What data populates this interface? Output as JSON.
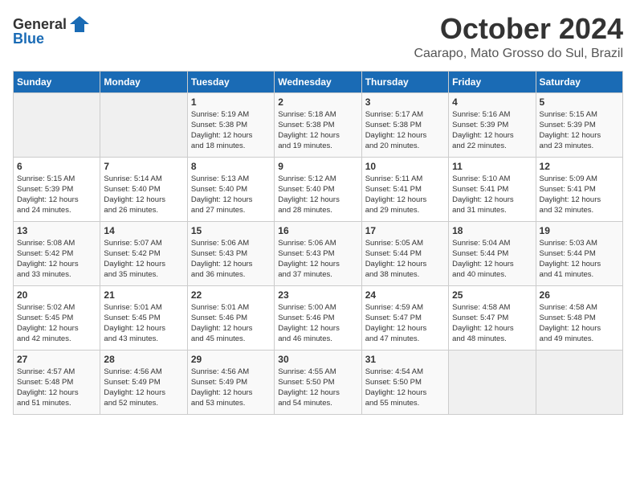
{
  "header": {
    "logo_general": "General",
    "logo_blue": "Blue",
    "month": "October 2024",
    "location": "Caarapo, Mato Grosso do Sul, Brazil"
  },
  "weekdays": [
    "Sunday",
    "Monday",
    "Tuesday",
    "Wednesday",
    "Thursday",
    "Friday",
    "Saturday"
  ],
  "weeks": [
    [
      {
        "day": "",
        "info": ""
      },
      {
        "day": "",
        "info": ""
      },
      {
        "day": "1",
        "info": "Sunrise: 5:19 AM\nSunset: 5:38 PM\nDaylight: 12 hours\nand 18 minutes."
      },
      {
        "day": "2",
        "info": "Sunrise: 5:18 AM\nSunset: 5:38 PM\nDaylight: 12 hours\nand 19 minutes."
      },
      {
        "day": "3",
        "info": "Sunrise: 5:17 AM\nSunset: 5:38 PM\nDaylight: 12 hours\nand 20 minutes."
      },
      {
        "day": "4",
        "info": "Sunrise: 5:16 AM\nSunset: 5:39 PM\nDaylight: 12 hours\nand 22 minutes."
      },
      {
        "day": "5",
        "info": "Sunrise: 5:15 AM\nSunset: 5:39 PM\nDaylight: 12 hours\nand 23 minutes."
      }
    ],
    [
      {
        "day": "6",
        "info": "Sunrise: 5:15 AM\nSunset: 5:39 PM\nDaylight: 12 hours\nand 24 minutes."
      },
      {
        "day": "7",
        "info": "Sunrise: 5:14 AM\nSunset: 5:40 PM\nDaylight: 12 hours\nand 26 minutes."
      },
      {
        "day": "8",
        "info": "Sunrise: 5:13 AM\nSunset: 5:40 PM\nDaylight: 12 hours\nand 27 minutes."
      },
      {
        "day": "9",
        "info": "Sunrise: 5:12 AM\nSunset: 5:40 PM\nDaylight: 12 hours\nand 28 minutes."
      },
      {
        "day": "10",
        "info": "Sunrise: 5:11 AM\nSunset: 5:41 PM\nDaylight: 12 hours\nand 29 minutes."
      },
      {
        "day": "11",
        "info": "Sunrise: 5:10 AM\nSunset: 5:41 PM\nDaylight: 12 hours\nand 31 minutes."
      },
      {
        "day": "12",
        "info": "Sunrise: 5:09 AM\nSunset: 5:41 PM\nDaylight: 12 hours\nand 32 minutes."
      }
    ],
    [
      {
        "day": "13",
        "info": "Sunrise: 5:08 AM\nSunset: 5:42 PM\nDaylight: 12 hours\nand 33 minutes."
      },
      {
        "day": "14",
        "info": "Sunrise: 5:07 AM\nSunset: 5:42 PM\nDaylight: 12 hours\nand 35 minutes."
      },
      {
        "day": "15",
        "info": "Sunrise: 5:06 AM\nSunset: 5:43 PM\nDaylight: 12 hours\nand 36 minutes."
      },
      {
        "day": "16",
        "info": "Sunrise: 5:06 AM\nSunset: 5:43 PM\nDaylight: 12 hours\nand 37 minutes."
      },
      {
        "day": "17",
        "info": "Sunrise: 5:05 AM\nSunset: 5:44 PM\nDaylight: 12 hours\nand 38 minutes."
      },
      {
        "day": "18",
        "info": "Sunrise: 5:04 AM\nSunset: 5:44 PM\nDaylight: 12 hours\nand 40 minutes."
      },
      {
        "day": "19",
        "info": "Sunrise: 5:03 AM\nSunset: 5:44 PM\nDaylight: 12 hours\nand 41 minutes."
      }
    ],
    [
      {
        "day": "20",
        "info": "Sunrise: 5:02 AM\nSunset: 5:45 PM\nDaylight: 12 hours\nand 42 minutes."
      },
      {
        "day": "21",
        "info": "Sunrise: 5:01 AM\nSunset: 5:45 PM\nDaylight: 12 hours\nand 43 minutes."
      },
      {
        "day": "22",
        "info": "Sunrise: 5:01 AM\nSunset: 5:46 PM\nDaylight: 12 hours\nand 45 minutes."
      },
      {
        "day": "23",
        "info": "Sunrise: 5:00 AM\nSunset: 5:46 PM\nDaylight: 12 hours\nand 46 minutes."
      },
      {
        "day": "24",
        "info": "Sunrise: 4:59 AM\nSunset: 5:47 PM\nDaylight: 12 hours\nand 47 minutes."
      },
      {
        "day": "25",
        "info": "Sunrise: 4:58 AM\nSunset: 5:47 PM\nDaylight: 12 hours\nand 48 minutes."
      },
      {
        "day": "26",
        "info": "Sunrise: 4:58 AM\nSunset: 5:48 PM\nDaylight: 12 hours\nand 49 minutes."
      }
    ],
    [
      {
        "day": "27",
        "info": "Sunrise: 4:57 AM\nSunset: 5:48 PM\nDaylight: 12 hours\nand 51 minutes."
      },
      {
        "day": "28",
        "info": "Sunrise: 4:56 AM\nSunset: 5:49 PM\nDaylight: 12 hours\nand 52 minutes."
      },
      {
        "day": "29",
        "info": "Sunrise: 4:56 AM\nSunset: 5:49 PM\nDaylight: 12 hours\nand 53 minutes."
      },
      {
        "day": "30",
        "info": "Sunrise: 4:55 AM\nSunset: 5:50 PM\nDaylight: 12 hours\nand 54 minutes."
      },
      {
        "day": "31",
        "info": "Sunrise: 4:54 AM\nSunset: 5:50 PM\nDaylight: 12 hours\nand 55 minutes."
      },
      {
        "day": "",
        "info": ""
      },
      {
        "day": "",
        "info": ""
      }
    ]
  ]
}
